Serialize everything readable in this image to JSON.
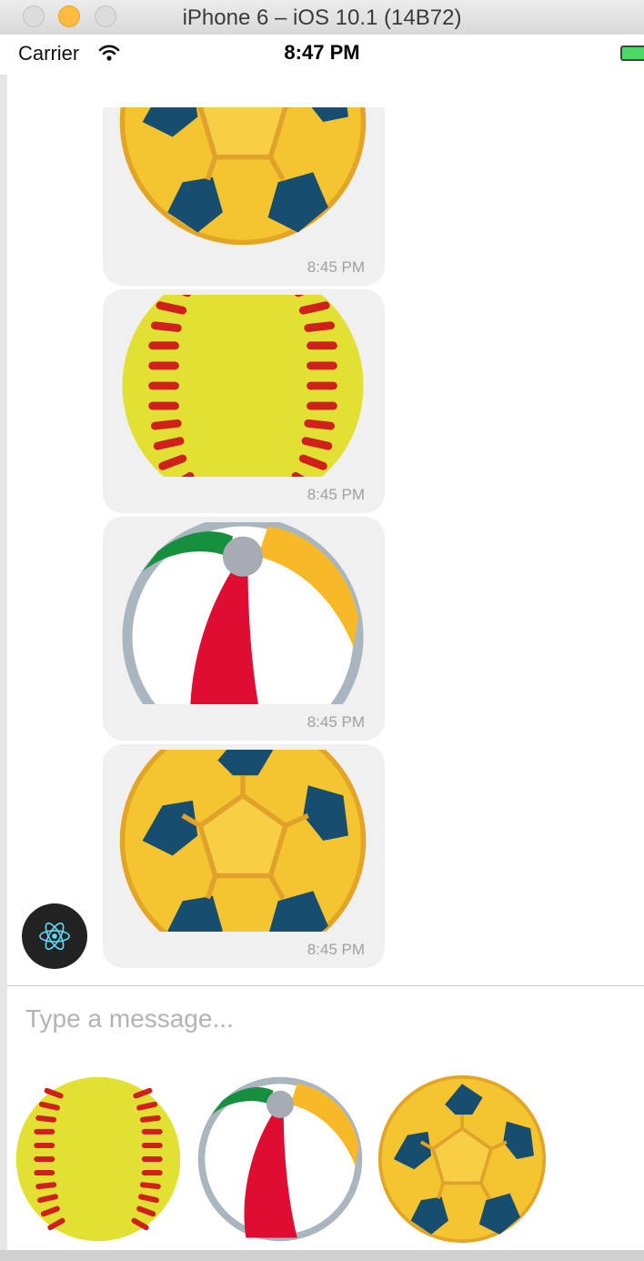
{
  "window": {
    "title": "iPhone 6 – iOS 10.1 (14B72)",
    "buttons": [
      "close",
      "minimize",
      "zoom"
    ]
  },
  "status_bar": {
    "carrier": "Carrier",
    "time": "8:47 PM",
    "icons": [
      "wifi-icon",
      "battery-icon"
    ]
  },
  "messages": [
    {
      "image": "futsal-ball",
      "time": "8:45 PM"
    },
    {
      "image": "softball",
      "time": "8:45 PM"
    },
    {
      "image": "beach-ball",
      "time": "8:45 PM"
    },
    {
      "image": "futsal-ball",
      "time": "8:45 PM"
    }
  ],
  "avatar": {
    "icon": "react-atom-icon"
  },
  "composer": {
    "placeholder": "Type a message..."
  },
  "sticker_picker": [
    {
      "image": "softball"
    },
    {
      "image": "beach-ball"
    },
    {
      "image": "futsal-ball"
    }
  ],
  "colors": {
    "bubble": "#f0f0f0",
    "timestamp": "#a0a0a0",
    "placeholder": "#b3b3b3",
    "avatar_bg": "#222222",
    "react_blue": "#61dafb",
    "battery": "#4cd964"
  }
}
